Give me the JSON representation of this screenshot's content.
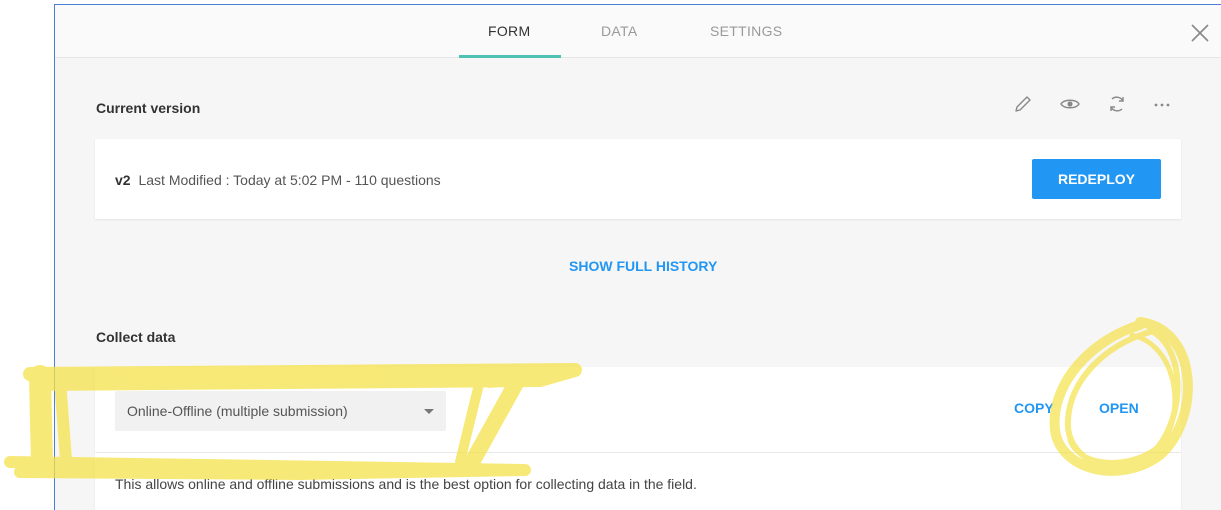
{
  "tabs": [
    {
      "label": "FORM",
      "active": true
    },
    {
      "label": "DATA",
      "active": false
    },
    {
      "label": "SETTINGS",
      "active": false
    }
  ],
  "current_version": {
    "title": "Current version",
    "tools": [
      "pencil-icon",
      "eye-icon",
      "refresh-icon",
      "more-icon"
    ],
    "version": "v2",
    "details": "Last Modified : Today at 5:02 PM - 110 questions",
    "redeploy_label": "REDEPLOY",
    "history_label": "SHOW FULL HISTORY"
  },
  "collect_data": {
    "title": "Collect data",
    "selected_option": "Online-Offline (multiple submission)",
    "copy_label": "COPY",
    "open_label": "OPEN",
    "description": "This allows online and offline submissions and is the best option for collecting data in the field."
  },
  "colors": {
    "accent": "#2196f3",
    "tab_underline": "#4ec2b3",
    "highlighter": "#f5e24a"
  }
}
